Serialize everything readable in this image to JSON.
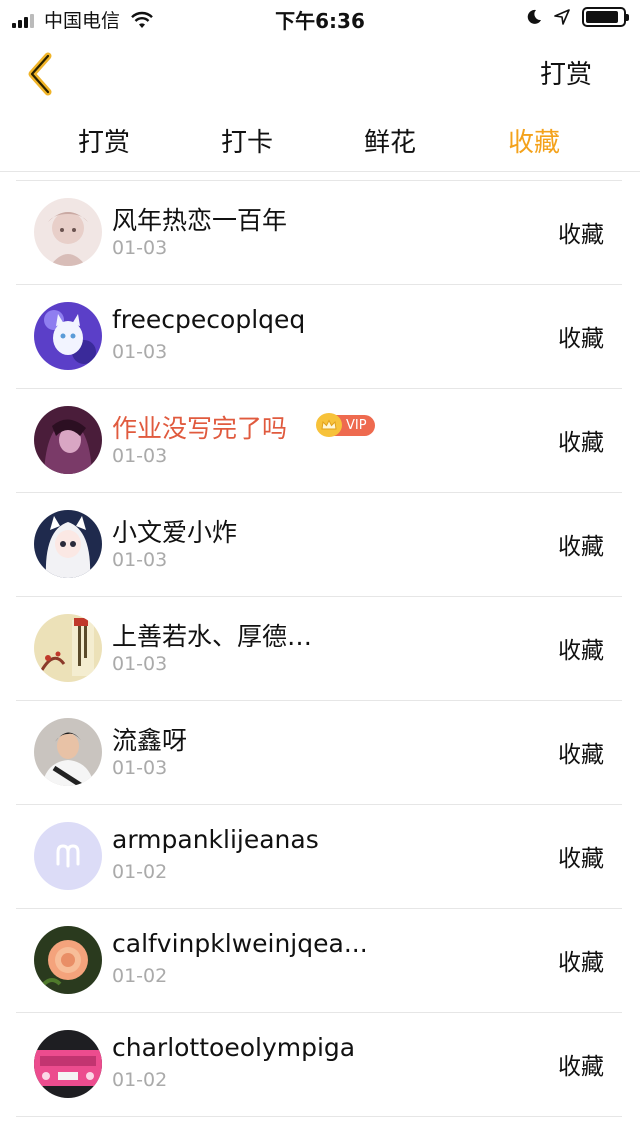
{
  "status_bar": {
    "carrier": "中国电信",
    "time": "下午6:36",
    "icons": [
      "signal-icon",
      "wifi-icon",
      "moon-icon",
      "location-icon",
      "battery-icon"
    ]
  },
  "nav": {
    "back_icon": "chevron-left-icon",
    "action_label": "打赏"
  },
  "tabs": [
    {
      "label": "打赏",
      "active": false
    },
    {
      "label": "打卡",
      "active": false
    },
    {
      "label": "鲜花",
      "active": false
    },
    {
      "label": "收藏",
      "active": true
    }
  ],
  "colors": {
    "accent": "#f4a21b",
    "vip_name": "#e05a3e",
    "vip_tag": "#ee6a4f",
    "date_text": "#aaaaaa",
    "divider": "#e6e6e6"
  },
  "list": {
    "items": [
      {
        "name": "风年热恋一百年",
        "date": "01-03",
        "action": "收藏"
      },
      {
        "name": "freecpecoplqeq",
        "date": "01-03",
        "action": "收藏"
      },
      {
        "name": "作业没写完了吗",
        "date": "01-03",
        "action": "收藏",
        "vip": true,
        "vip_label": "VIP"
      },
      {
        "name": "小文爱小炸",
        "date": "01-03",
        "action": "收藏"
      },
      {
        "name": "上善若水、厚德…",
        "date": "01-03",
        "action": "收藏"
      },
      {
        "name": "流鑫呀",
        "date": "01-03",
        "action": "收藏"
      },
      {
        "name": "armpanklijeanas",
        "date": "01-02",
        "action": "收藏"
      },
      {
        "name": "calfvinpklweinjqea...",
        "date": "01-02",
        "action": "收藏"
      },
      {
        "name": "charlottoeolympiga",
        "date": "01-02",
        "action": "收藏"
      }
    ]
  }
}
